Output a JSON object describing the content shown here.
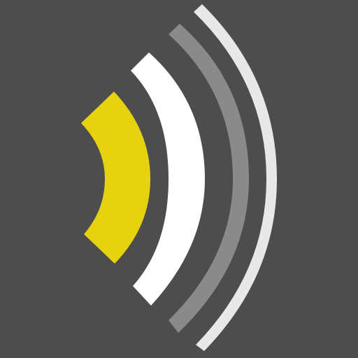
{
  "icon": {
    "name": "signal-waves-icon",
    "background": "#4d4d4d",
    "colors": {
      "wave1": "#e6d20f",
      "wave2": "#ffffff",
      "wave3": "#8a8a8a",
      "wave4": "#e8e8e8"
    }
  }
}
